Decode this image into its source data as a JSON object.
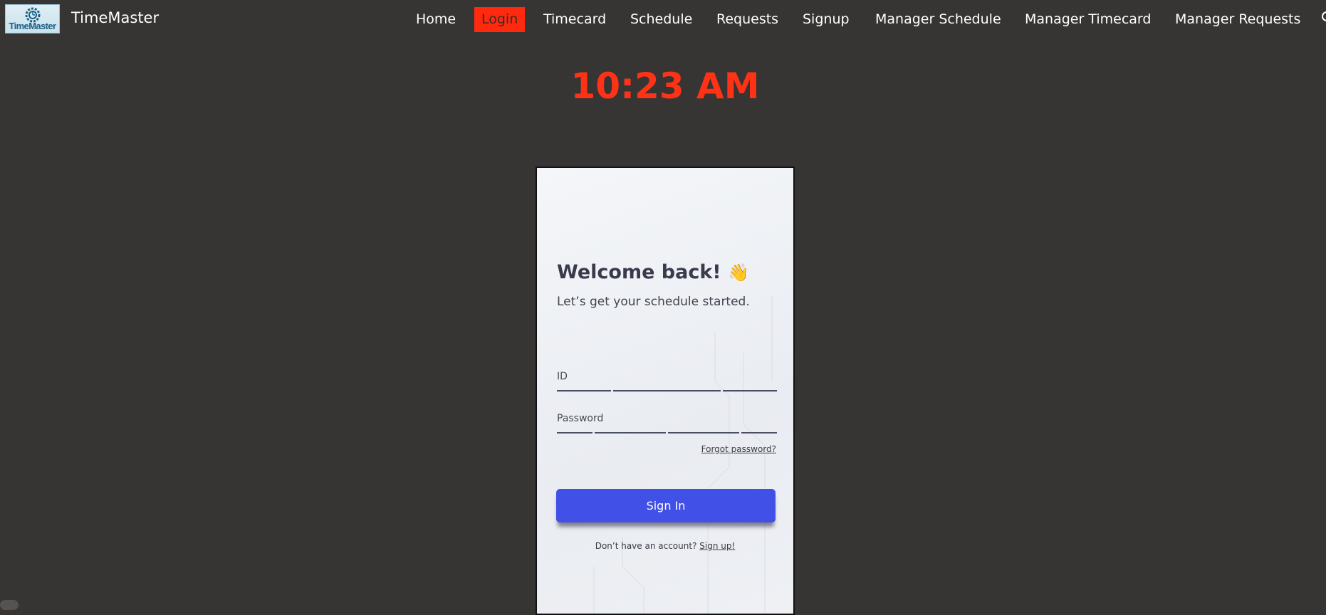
{
  "app": {
    "brand": "TimeMaster",
    "logo_text": "TimeMaster"
  },
  "nav": {
    "items": [
      {
        "label": "Home",
        "active": false
      },
      {
        "label": "Login",
        "active": true
      },
      {
        "label": "Timecard",
        "active": false
      },
      {
        "label": "Schedule",
        "active": false
      },
      {
        "label": "Requests",
        "active": false
      },
      {
        "label": "Signup",
        "active": false
      },
      {
        "label": "Manager Schedule",
        "active": false
      },
      {
        "label": "Manager Timecard",
        "active": false
      },
      {
        "label": "Manager Requests",
        "active": false
      }
    ]
  },
  "clock": {
    "time": "10:23 AM"
  },
  "login": {
    "title": "Welcome back!",
    "title_emoji": "👋",
    "subtitle": "Let’s get your schedule started.",
    "id_label": "ID",
    "password_label": "Password",
    "forgot": "Forgot password?",
    "submit": "Sign In",
    "no_account": "Don’t have an account?",
    "signup_link": "Sign up!"
  },
  "colors": {
    "background": "#373534",
    "accent_red": "#ff2a0e",
    "button_blue": "#4150e6"
  }
}
